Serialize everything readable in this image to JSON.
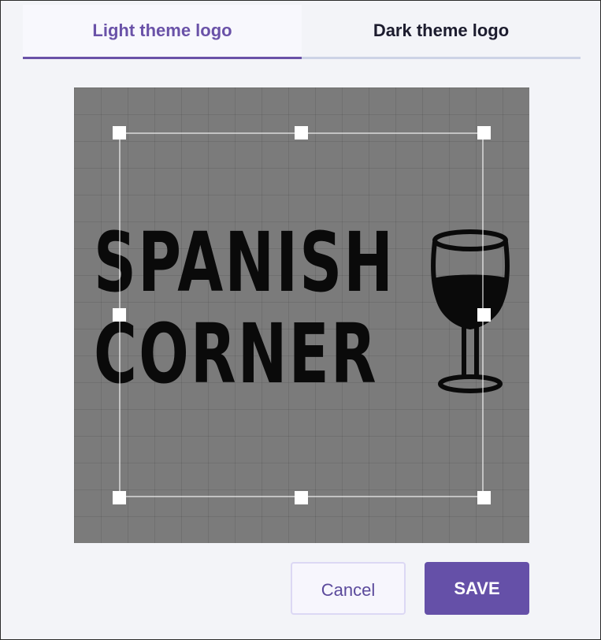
{
  "tabs": {
    "light": {
      "label": "Light theme logo",
      "active": true
    },
    "dark": {
      "label": "Dark theme logo",
      "active": false
    }
  },
  "logo": {
    "line1": "SPANISH",
    "line2": "CORNER",
    "icon": "wine-glass-icon"
  },
  "buttons": {
    "cancel_label": "Cancel",
    "save_label": "SAVE"
  },
  "colors": {
    "accent": "#6550a8",
    "canvas": "#7b7b7b",
    "background": "#f3f4f8"
  }
}
